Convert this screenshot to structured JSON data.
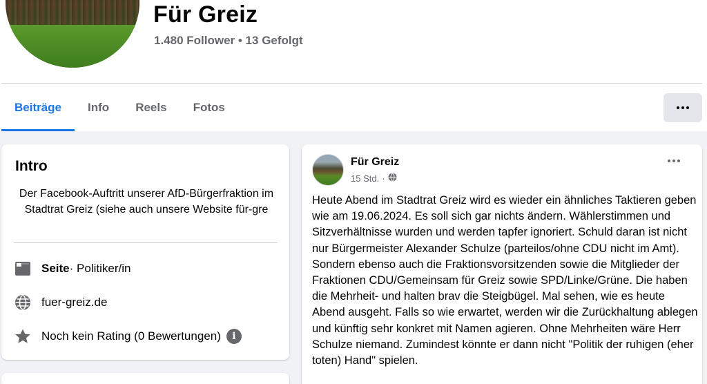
{
  "profile": {
    "name": "Für Greiz",
    "follow_info": "1.480 Follower • 13 Gefolgt"
  },
  "tabs": [
    {
      "label": "Beiträge",
      "active": true
    },
    {
      "label": "Info",
      "active": false
    },
    {
      "label": "Reels",
      "active": false
    },
    {
      "label": "Fotos",
      "active": false
    }
  ],
  "more_button_icon": "more-horizontal-icon",
  "intro": {
    "title": "Intro",
    "description": "Der Facebook-Auftritt unserer AfD-Bürgerfraktion im Stadtrat Greiz (siehe auch unsere Website für-gre",
    "category_label": "Seite",
    "category_value": " · Politiker/in",
    "website": "fuer-greiz.de",
    "rating": "Noch kein Rating (0 Bewertungen)",
    "info_icon_text": "i"
  },
  "post": {
    "author": "Für Greiz",
    "time": "15 Std.",
    "separator": "·",
    "text": "Heute Abend im Stadtrat Greiz wird es wieder ein ähnliches Taktieren geben wie am 19.06.2024. Es soll sich gar nichts ändern. Wählerstimmen und Sitzverhältnisse wurden und werden tapfer ignoriert. Schuld daran ist nicht nur Bürgermeister Alexander Schulze (parteilos/ohne CDU nicht im Amt). Sondern ebenso auch die Fraktionsvorsitzenden sowie die Mitglieder der Fraktionen CDU/Gemeinsam für Greiz sowie SPD/Linke/Grüne. Die haben die Mehrheit- und halten brav die Steigbügel. Mal sehen, wie es heute Abend ausgeht. Falls so wie erwartet, werden wir die Zurückhaltung ablegen und künftig sehr konkret mit Namen agieren. Ohne Mehrheiten wäre Herr Schulze niemand. Zumindest könnte er dann nicht \"Politik der ruhigen (eher toten) Hand\" spielen."
  },
  "colors": {
    "accent": "#1b74e4",
    "background": "#f0f2f5",
    "secondary_text": "#65676b"
  }
}
